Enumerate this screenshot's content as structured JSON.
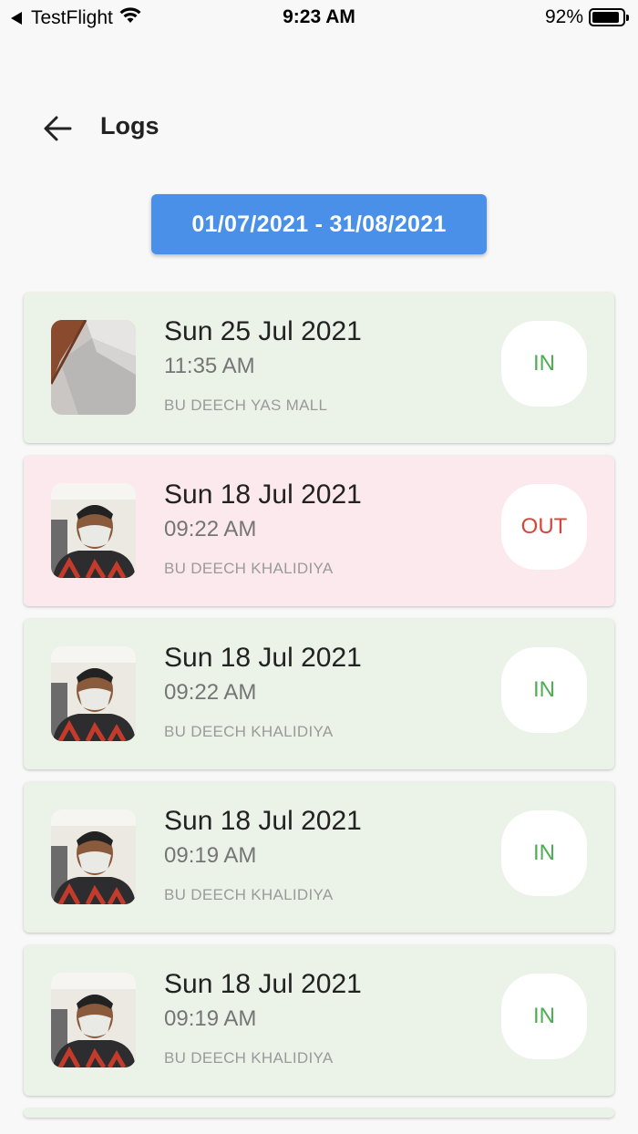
{
  "status_bar": {
    "carrier": "TestFlight",
    "time": "9:23 AM",
    "battery": "92%",
    "battery_level": 0.92
  },
  "header": {
    "title": "Logs"
  },
  "date_range": {
    "label": "01/07/2021 - 31/08/2021"
  },
  "logs": [
    {
      "date": "Sun 25 Jul 2021",
      "time": "11:35 AM",
      "location": "BU DEECH YAS MALL",
      "status": "IN",
      "thumb": "room-ceiling-photo"
    },
    {
      "date": "Sun 18 Jul 2021",
      "time": "09:22 AM",
      "location": "BU DEECH KHALIDIYA",
      "status": "OUT",
      "thumb": "selfie-photo"
    },
    {
      "date": "Sun 18 Jul 2021",
      "time": "09:22 AM",
      "location": "BU DEECH KHALIDIYA",
      "status": "IN",
      "thumb": "selfie-photo"
    },
    {
      "date": "Sun 18 Jul 2021",
      "time": "09:19 AM",
      "location": "BU DEECH KHALIDIYA",
      "status": "IN",
      "thumb": "selfie-photo"
    },
    {
      "date": "Sun 18 Jul 2021",
      "time": "09:19 AM",
      "location": "BU DEECH KHALIDIYA",
      "status": "IN",
      "thumb": "selfie-photo"
    }
  ],
  "colors": {
    "accent": "#4a90e8",
    "in_card": "#ebf3e8",
    "out_card": "#fbe9ed",
    "in_text": "#4caf50",
    "out_text": "#d9443a"
  }
}
